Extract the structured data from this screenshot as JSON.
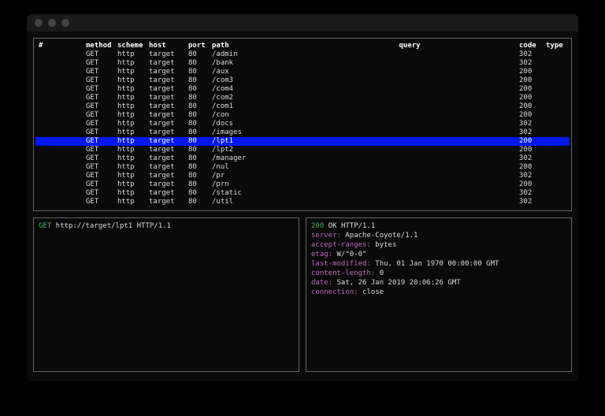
{
  "columns": [
    "#",
    "method",
    "scheme",
    "host",
    "port",
    "path",
    "query",
    "code",
    "type"
  ],
  "rows": [
    {
      "method": "GET",
      "scheme": "http",
      "host": "target",
      "port": "80",
      "path": "/admin",
      "code": "302"
    },
    {
      "method": "GET",
      "scheme": "http",
      "host": "target",
      "port": "80",
      "path": "/bank",
      "code": "302"
    },
    {
      "method": "GET",
      "scheme": "http",
      "host": "target",
      "port": "80",
      "path": "/aux",
      "code": "200"
    },
    {
      "method": "GET",
      "scheme": "http",
      "host": "target",
      "port": "80",
      "path": "/com3",
      "code": "200"
    },
    {
      "method": "GET",
      "scheme": "http",
      "host": "target",
      "port": "80",
      "path": "/com4",
      "code": "200"
    },
    {
      "method": "GET",
      "scheme": "http",
      "host": "target",
      "port": "80",
      "path": "/com2",
      "code": "200"
    },
    {
      "method": "GET",
      "scheme": "http",
      "host": "target",
      "port": "80",
      "path": "/com1",
      "code": "200"
    },
    {
      "method": "GET",
      "scheme": "http",
      "host": "target",
      "port": "80",
      "path": "/con",
      "code": "200"
    },
    {
      "method": "GET",
      "scheme": "http",
      "host": "target",
      "port": "80",
      "path": "/docs",
      "code": "302"
    },
    {
      "method": "GET",
      "scheme": "http",
      "host": "target",
      "port": "80",
      "path": "/images",
      "code": "302"
    },
    {
      "method": "GET",
      "scheme": "http",
      "host": "target",
      "port": "80",
      "path": "/lpt1",
      "code": "200",
      "selected": true
    },
    {
      "method": "GET",
      "scheme": "http",
      "host": "target",
      "port": "80",
      "path": "/lpt2",
      "code": "200"
    },
    {
      "method": "GET",
      "scheme": "http",
      "host": "target",
      "port": "80",
      "path": "/manager",
      "code": "302"
    },
    {
      "method": "GET",
      "scheme": "http",
      "host": "target",
      "port": "80",
      "path": "/nul",
      "code": "200"
    },
    {
      "method": "GET",
      "scheme": "http",
      "host": "target",
      "port": "80",
      "path": "/pr",
      "code": "302"
    },
    {
      "method": "GET",
      "scheme": "http",
      "host": "target",
      "port": "80",
      "path": "/prn",
      "code": "200"
    },
    {
      "method": "GET",
      "scheme": "http",
      "host": "target",
      "port": "80",
      "path": "/static",
      "code": "302"
    },
    {
      "method": "GET",
      "scheme": "http",
      "host": "target",
      "port": "80",
      "path": "/util",
      "code": "302"
    }
  ],
  "request": {
    "method": "GET",
    "line_rest": " http://target/lpt1 HTTP/1.1"
  },
  "response": {
    "status_code": "200",
    "status_rest": " OK HTTP/1.1",
    "headers": [
      {
        "k": "server:",
        "v": " Apache-Coyote/1.1"
      },
      {
        "k": "accept-ranges:",
        "v": " bytes"
      },
      {
        "k": "etag:",
        "v": " W/\"0-0\""
      },
      {
        "k": "last-modified:",
        "v": " Thu, 01 Jan 1970 00:00:00 GMT"
      },
      {
        "k": "content-length:",
        "v": " 0"
      },
      {
        "k": "date:",
        "v": " Sat, 26 Jan 2019 20:06:26 GMT"
      },
      {
        "k": "connection:",
        "v": " close"
      }
    ]
  }
}
